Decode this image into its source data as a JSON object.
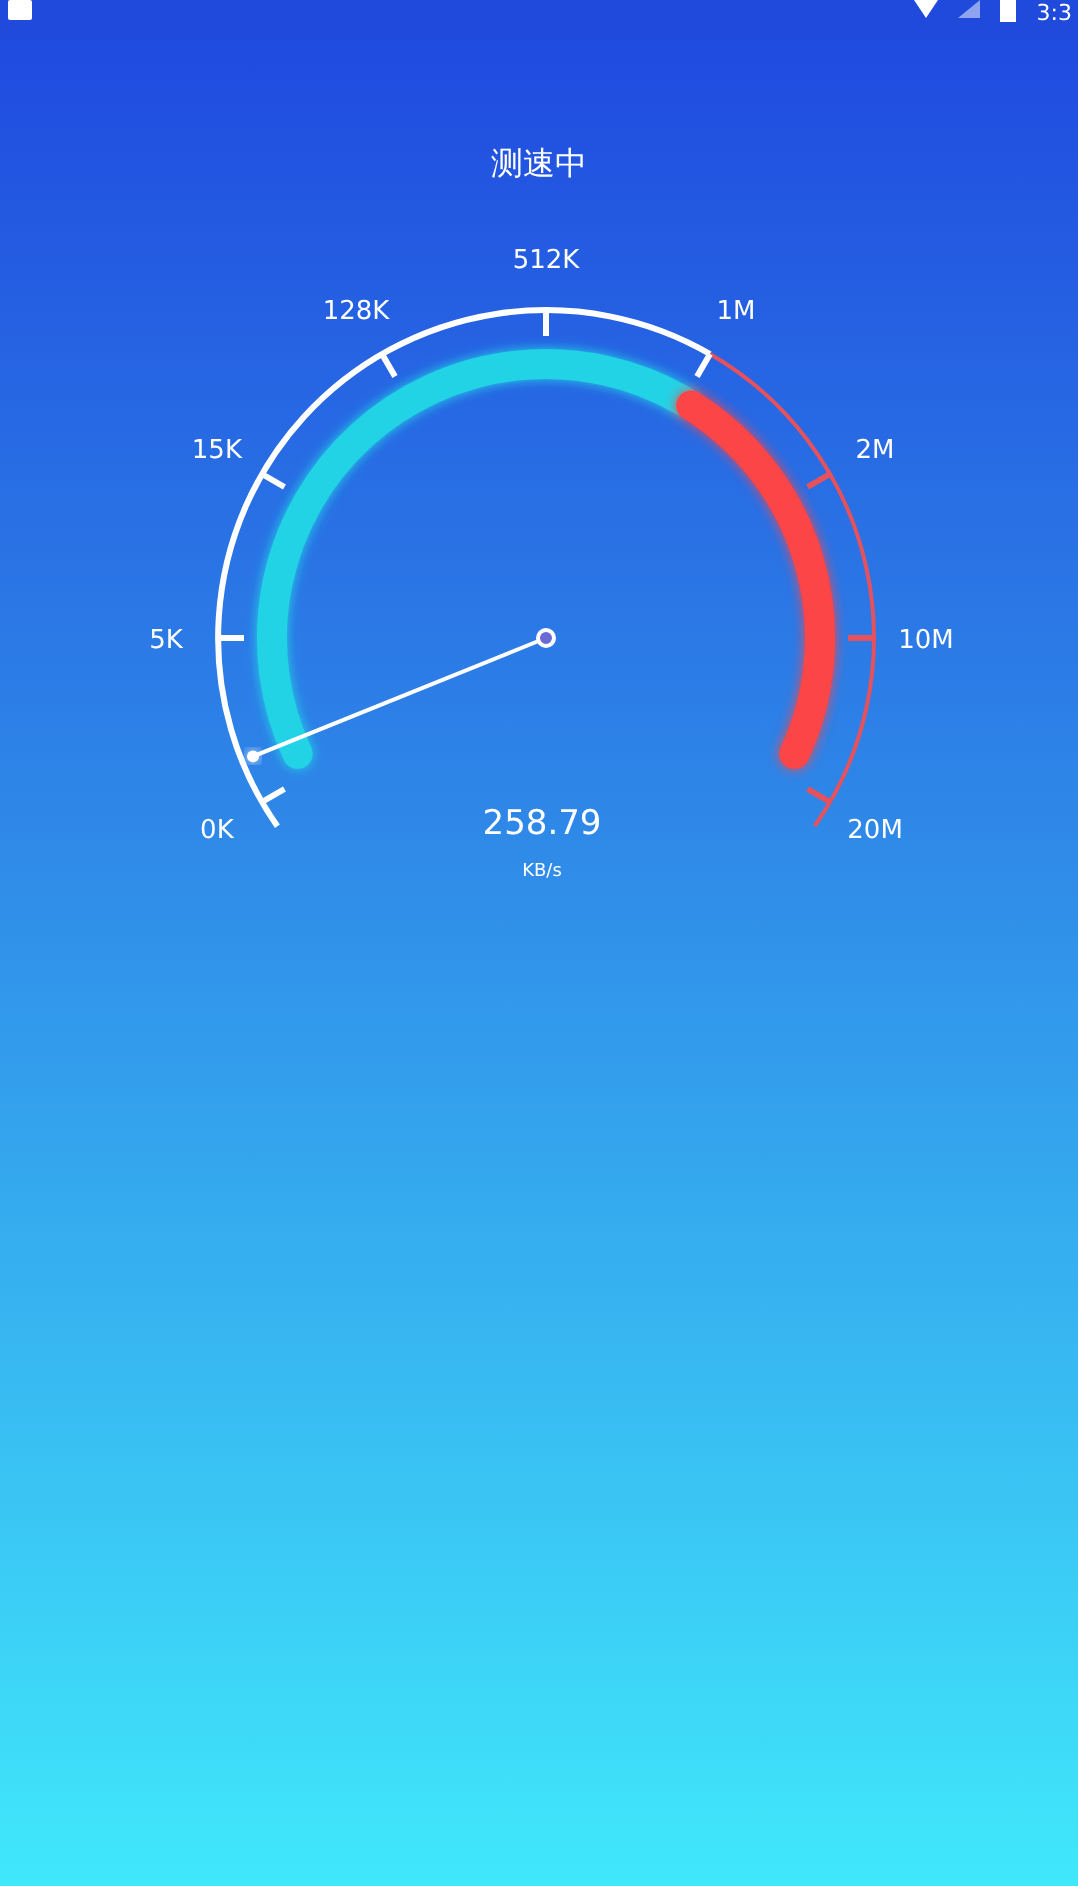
{
  "status_bar": {
    "time": "3:3"
  },
  "title": "测速中",
  "gauge": {
    "scale": [
      "0K",
      "5K",
      "15K",
      "128K",
      "512K",
      "1M",
      "2M",
      "10M",
      "20M"
    ],
    "value": "258.79",
    "unit": "KB/s"
  }
}
